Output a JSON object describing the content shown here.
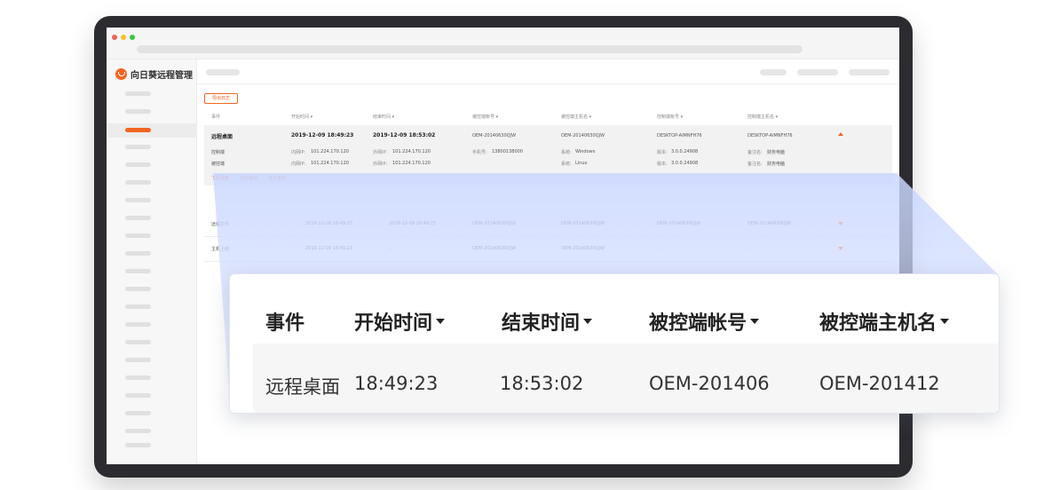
{
  "app": {
    "brand_name": "向日葵远程管理",
    "brand_color": "#f26522"
  },
  "toolbar": {
    "export_label": "导出日志"
  },
  "mini_table": {
    "columns": [
      "事件",
      "开始时间 ▾",
      "结束时间 ▾",
      "被控端帐号 ▾",
      "被控端主机名 ▾",
      "控制端帐号 ▾",
      "控制端主机名 ▾"
    ],
    "expanded_row": {
      "event": "远程桌面",
      "start": "2019-12-09 18:49:23",
      "end": "2019-12-09 18:53:02",
      "controlled_account": "OEM-20140630QJW",
      "controlled_host": "OEM-20140630QJW",
      "controller_account": "DESKTOP-AIMNFH76",
      "controller_host": "DESKTOP-AIMNFH76",
      "details": [
        {
          "role": "控制端",
          "intranet_label": "内网IP:",
          "intranet_ip": "101.224.170.120",
          "extranet_label": "外网IP:",
          "extranet_ip": "101.224.170.120",
          "phone_label": "手机号:",
          "phone": "13800138000",
          "os_label": "系统:",
          "os": "Windows",
          "version_label": "版本:",
          "version": "3.0.0.24908",
          "note_label": "备注名:",
          "note": "财务电脑"
        },
        {
          "role": "被控端",
          "intranet_label": "内网IP:",
          "intranet_ip": "101.224.170.120",
          "extranet_label": "外网IP:",
          "extranet_ip": "101.224.170.120",
          "phone_label": "",
          "phone": "",
          "os_label": "系统:",
          "os": "Linux",
          "version_label": "版本:",
          "version": "3.0.0.24908",
          "note_label": "备注名:",
          "note": "财务电脑"
        }
      ],
      "actions": [
        "下载录像",
        "文件操作",
        "指令查询"
      ]
    },
    "rows": [
      {
        "event": "远程文件",
        "start": "2019-12-09 18:49:23",
        "end": "2019-12-09 18:49:23",
        "controlled_account": "OEM-20140630QJW",
        "controlled_host": "OEM-20140630QJW",
        "controller_account": "OEM-20140630QJW",
        "controller_host": "OEM-20140630QJW"
      },
      {
        "event": "主机上线",
        "start": "2019-12-09 18:49:23",
        "end": "–",
        "controlled_account": "OEM-20140630QJW",
        "controlled_host": "OEM-20140630QJW",
        "controller_account": "–",
        "controller_host": "–"
      }
    ]
  },
  "zoom_card": {
    "headers": [
      "事件",
      "开始时间",
      "结束时间",
      "被控端帐号",
      "被控端主机名"
    ],
    "row": [
      "远程桌面",
      "18:49:23",
      "18:53:02",
      "OEM-201406",
      "OEM-201412"
    ]
  }
}
